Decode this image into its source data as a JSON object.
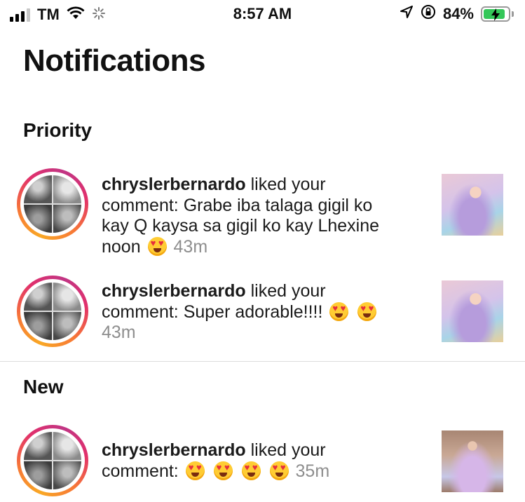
{
  "status_bar": {
    "carrier": "TM",
    "time": "8:57 AM",
    "battery": "84%",
    "icons": [
      "signal-icon",
      "wifi-icon",
      "activity-spinner-icon",
      "location-arrow-icon",
      "orientation-lock-icon",
      "battery-charging-icon"
    ],
    "battery_color": "#34c759"
  },
  "page": {
    "title": "Notifications"
  },
  "sections": {
    "priority": "Priority",
    "new": "New"
  },
  "notifications": [
    {
      "user": "chryslerbernardo",
      "action": " liked your comment: Grabe iba talaga gigil ko kay Q kaysa sa gigil ko kay Lhexine noon ",
      "emojis": "😍",
      "time": "43m"
    },
    {
      "user": "chryslerbernardo",
      "action": " liked your comment: Super adorable!!!! ",
      "emojis": "😍 😍",
      "time": "43m"
    },
    {
      "user": "chryslerbernardo",
      "action": " liked your comment: ",
      "emojis": "😍 😍 😍 😍",
      "time": "35m"
    }
  ],
  "colors": {
    "story_ring_start": "#f9a825",
    "story_ring_end": "#c13584",
    "timestamp": "#8e8e8e"
  }
}
